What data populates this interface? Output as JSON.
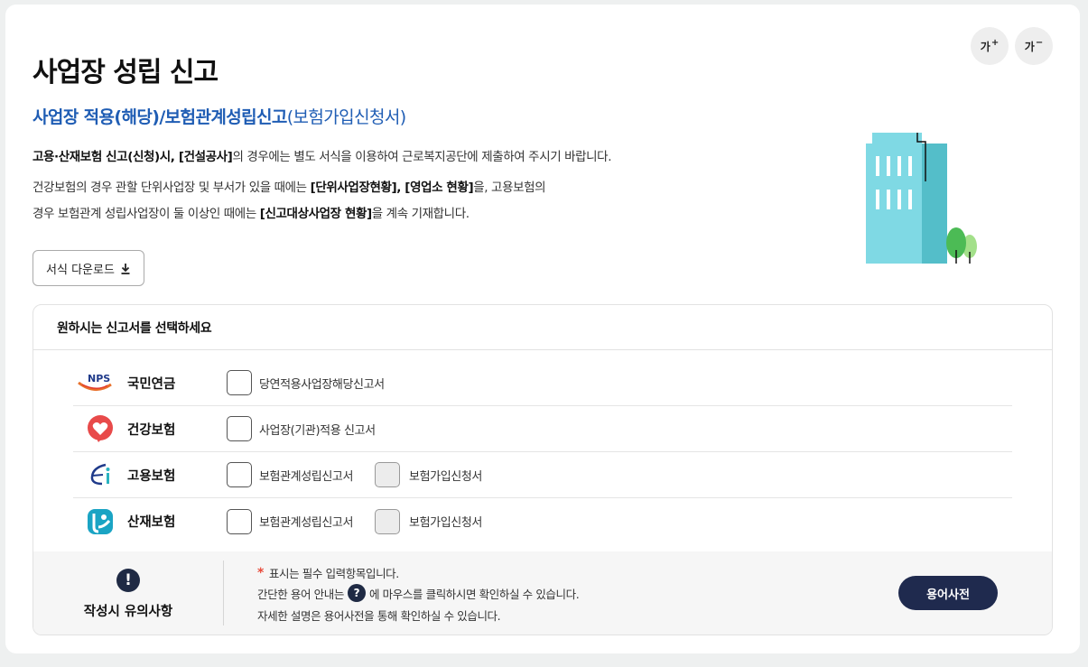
{
  "font_controls": {
    "increase_label": "가",
    "increase_sign": "+",
    "decrease_label": "가",
    "decrease_sign": "−"
  },
  "page": {
    "title": "사업장 성립 신고",
    "subtitle_bold": "사업장 적용(해당)/보험관계성립신고",
    "subtitle_rest": "(보험가입신청서)"
  },
  "description": {
    "line1_b1": "고용·산재보험 신고(신청)시, [건설공사]",
    "line1_rest": "의 경우에는 별도 서식을 이용하여 근로복지공단에 제출하여 주시기 바랍니다.",
    "line2_pre": "건강보험의 경우 관할 단위사업장 및 부서가 있을 때에는 ",
    "line2_b1": "[단위사업장현황], [영업소 현황]",
    "line2_post": "을, 고용보험의",
    "line3_pre": "경우 보험관계 성립사업장이 둘 이상인 때에는 ",
    "line3_b1": "[신고대상사업장 현황]",
    "line3_post": "을 계속 기재합니다."
  },
  "download_button": {
    "label": "서식 다운로드"
  },
  "selection": {
    "heading": "원하시는 신고서를 선택하세요",
    "rows": [
      {
        "org": "국민연금",
        "logo": "nps-logo",
        "options": [
          {
            "label": "당연적용사업장해당신고서",
            "disabled": false
          }
        ]
      },
      {
        "org": "건강보험",
        "logo": "nhis-logo",
        "options": [
          {
            "label": "사업장(기관)적용 신고서",
            "disabled": false
          }
        ]
      },
      {
        "org": "고용보험",
        "logo": "ei-logo",
        "options": [
          {
            "label": "보험관계성립신고서",
            "disabled": false
          },
          {
            "label": "보험가입신청서",
            "disabled": true
          }
        ]
      },
      {
        "org": "산재보험",
        "logo": "comwel-logo",
        "options": [
          {
            "label": "보험관계성립신고서",
            "disabled": false
          },
          {
            "label": "보험가입신청서",
            "disabled": true
          }
        ]
      }
    ],
    "nps_logo_text": "NPS"
  },
  "notice": {
    "icon": "!",
    "title": "작성시 유의사항",
    "line1_star": "*",
    "line1": "표시는 필수 입력항목입니다.",
    "line2_pre": "간단한 용어 안내는",
    "line2_icon": "?",
    "line2_post": "에 마우스를 클릭하시면 확인하실 수 있습니다.",
    "line3": "자세한 설명은 용어사전을 통해 확인하실 수 있습니다.",
    "dict_button": "용어사전"
  },
  "colors": {
    "accent_blue": "#1f5db4",
    "navy": "#1f2a4e",
    "required_star": "#e84a3a"
  }
}
